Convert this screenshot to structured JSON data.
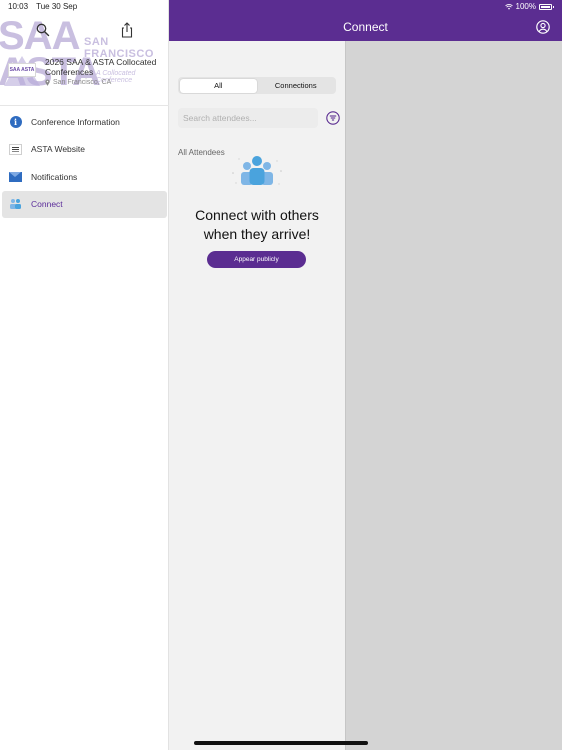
{
  "status_bar": {
    "time": "10:03",
    "date": "Tue 30 Sep",
    "battery": "100%"
  },
  "sidebar": {
    "banner": {
      "big_text": "SAA",
      "big_text_2": "ASTA",
      "city_text": "SAN FRANCISCO",
      "sub_text": "A Collocated Conference"
    },
    "thumb_text": "SAA ASTA",
    "event_title": "2026 SAA & ASTA Collocated Conferences",
    "event_location": "San Francisco, CA",
    "items": [
      {
        "label": "Conference Information",
        "icon": "info-icon"
      },
      {
        "label": "ASTA Website",
        "icon": "website-icon"
      },
      {
        "label": "Notifications",
        "icon": "mail-icon"
      },
      {
        "label": "Connect",
        "icon": "people-icon"
      }
    ],
    "active_item": "Connect"
  },
  "header": {
    "title": "Connect"
  },
  "connect": {
    "tabs": [
      "All",
      "Connections"
    ],
    "selected_tab": "All",
    "search_placeholder": "Search attendees...",
    "section_label": "All Attendees",
    "empty_title_line1": "Connect with others",
    "empty_title_line2": "when they arrive!",
    "appear_button": "Appear publicly"
  },
  "colors": {
    "brand_purple": "#5b2d91",
    "accent_blue": "#2f6cc0",
    "people_blue": "#4aa3dd"
  }
}
